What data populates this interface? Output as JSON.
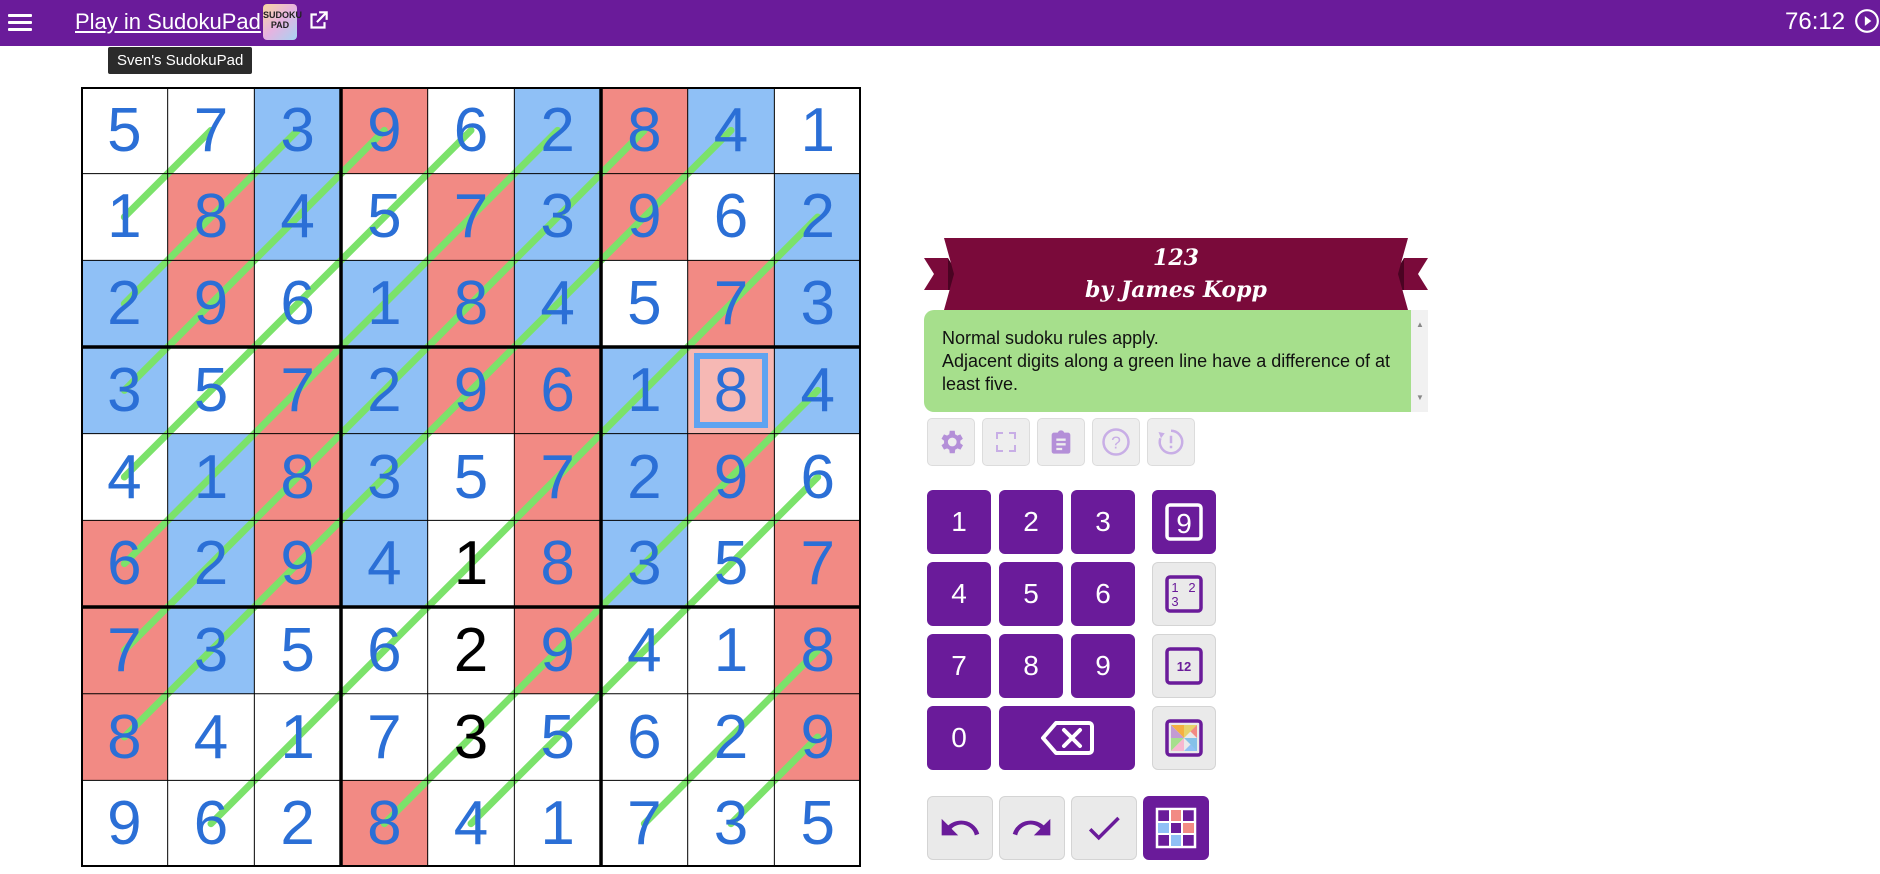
{
  "topbar": {
    "title": "Play in SudokuPad",
    "logo_text": "SUDOKU PAD",
    "timer": "76:12",
    "tooltip": "Sven's SudokuPad",
    "bar_color": "#6a1b9a"
  },
  "puzzle": {
    "title": "123",
    "author": "by James Kopp",
    "rules": [
      "Normal sudoku rules apply.",
      "Adjacent digits along a green line have a difference of at least five."
    ],
    "grid": [
      [
        5,
        7,
        3,
        9,
        6,
        2,
        8,
        4,
        1
      ],
      [
        1,
        8,
        4,
        5,
        7,
        3,
        9,
        6,
        2
      ],
      [
        2,
        9,
        6,
        1,
        8,
        4,
        5,
        7,
        3
      ],
      [
        3,
        5,
        7,
        2,
        9,
        6,
        1,
        8,
        4
      ],
      [
        4,
        1,
        8,
        3,
        5,
        7,
        2,
        9,
        6
      ],
      [
        6,
        2,
        9,
        4,
        1,
        8,
        3,
        5,
        7
      ],
      [
        7,
        3,
        5,
        6,
        2,
        9,
        4,
        1,
        8
      ],
      [
        8,
        4,
        1,
        7,
        3,
        5,
        6,
        2,
        9
      ],
      [
        9,
        6,
        2,
        8,
        4,
        1,
        7,
        3,
        5
      ]
    ],
    "givens": [
      [
        5,
        4
      ],
      [
        6,
        4
      ],
      [
        7,
        4
      ]
    ],
    "colors": [
      "WWBRWBRBW",
      "WRBWRBRWB",
      "BRWBRBWRB",
      "BWRBRRBPB",
      "WBRBWRBRW",
      "RBRBWRBWR",
      "RBWWWRWWR",
      "RWWWWWWWR",
      "WWWRWWWWW"
    ],
    "selected_cell": [
      3,
      7
    ],
    "green_lines": [
      [
        [
          1,
          0
        ],
        [
          0,
          1
        ]
      ],
      [
        [
          2,
          0
        ],
        [
          0,
          2
        ]
      ],
      [
        [
          3,
          0
        ],
        [
          0,
          3
        ]
      ],
      [
        [
          4,
          0
        ],
        [
          0,
          4
        ]
      ],
      [
        [
          5,
          0
        ],
        [
          1,
          4
        ],
        [
          0,
          5
        ]
      ],
      [
        [
          6,
          0
        ],
        [
          0,
          6
        ]
      ],
      [
        [
          7,
          0
        ],
        [
          0,
          7
        ]
      ],
      [
        [
          8,
          1
        ],
        [
          1,
          8
        ]
      ],
      [
        [
          8,
          3
        ],
        [
          3,
          8
        ]
      ],
      [
        [
          8,
          4
        ],
        [
          6,
          6
        ],
        [
          4,
          8
        ]
      ],
      [
        [
          8,
          6
        ],
        [
          6,
          8
        ]
      ],
      [
        [
          8,
          7
        ],
        [
          7,
          8
        ]
      ]
    ],
    "palette": {
      "B": "#8fc0f6",
      "R": "#f28a84",
      "W": "#ffffff",
      "P": "#f6b8b4",
      "line": "#7be26a",
      "digit": "#2b6fd6",
      "given": "#000000",
      "banner": "#7a0a3a",
      "rules_bg": "#a6df8c"
    }
  },
  "toolbar": {
    "tools": [
      "settings-icon",
      "fullscreen-icon",
      "rules-icon",
      "help-icon",
      "restart-icon"
    ]
  },
  "keypad": {
    "digits": [
      "1",
      "2",
      "3",
      "4",
      "5",
      "6",
      "7",
      "8",
      "9",
      "0"
    ],
    "modes": [
      "normal",
      "corner",
      "centre",
      "colour"
    ],
    "corner_sample": "1 2 3",
    "centre_sample": "12",
    "normal_sample": "9"
  },
  "actions": [
    "undo",
    "redo",
    "check",
    "grid-toggle"
  ]
}
